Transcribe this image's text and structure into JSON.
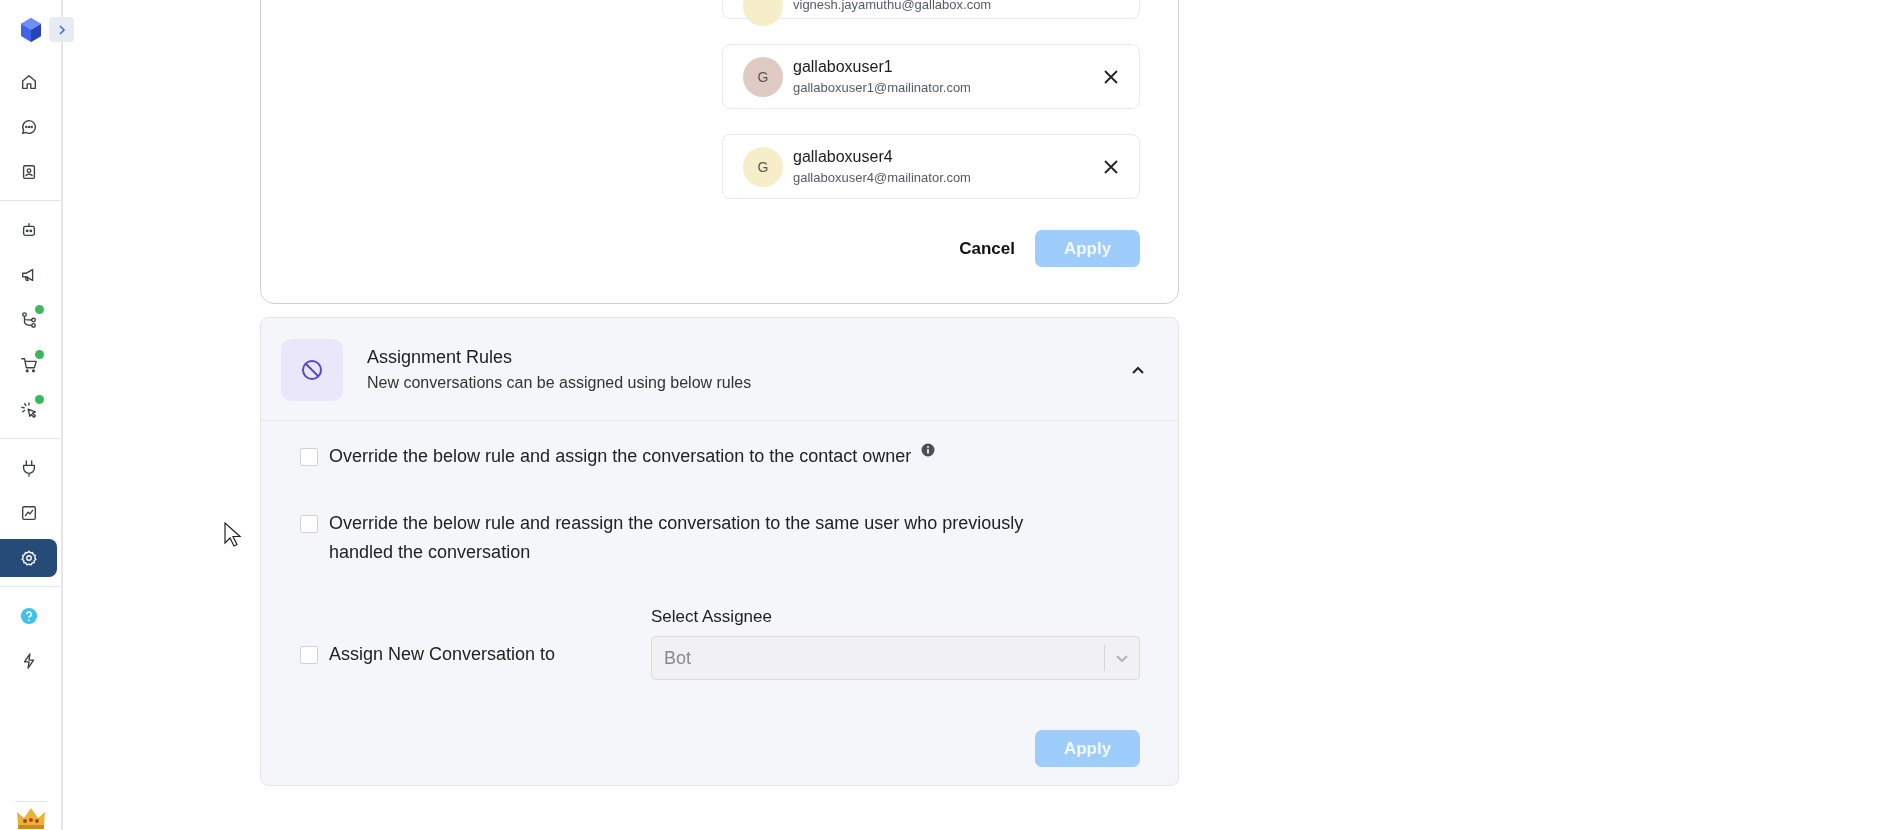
{
  "sidebar": {
    "groups": [
      [
        {
          "selected": false,
          "badge": false
        },
        {
          "selected": false,
          "badge": false
        },
        {
          "selected": false,
          "badge": false
        }
      ],
      [
        {
          "selected": false,
          "badge": false
        },
        {
          "selected": false,
          "badge": false
        },
        {
          "selected": false,
          "badge": true
        },
        {
          "selected": false,
          "badge": true
        },
        {
          "selected": false,
          "badge": true
        }
      ],
      [
        {
          "selected": false,
          "badge": false
        },
        {
          "selected": false,
          "badge": false
        },
        {
          "selected": true,
          "badge": false
        }
      ],
      [
        {
          "selected": false,
          "badge": false
        },
        {
          "selected": false,
          "badge": false
        }
      ]
    ]
  },
  "assignees": {
    "users": [
      {
        "email": "vignesh.jayamuthu@gallabox.com",
        "color": "#f6eec8"
      },
      {
        "initial": "G",
        "name": "gallaboxuser1",
        "email": "gallaboxuser1@mailinator.com",
        "color": "#e0cbc4"
      },
      {
        "initial": "G",
        "name": "gallaboxuser4",
        "email": "gallaboxuser4@mailinator.com",
        "color": "#f6eec8"
      }
    ],
    "cancel_button": {
      "label": "Cancel",
      "disabled": false
    },
    "apply_button": {
      "label": "Apply",
      "disabled": true
    }
  },
  "assignment_rules": {
    "title": "Assignment Rules",
    "subtitle": "New conversations can be assigned using below rules",
    "expanded": true,
    "rules": [
      {
        "kind": "checkbox",
        "label": "Override the below rule and assign the conversation to the contact owner",
        "checked": false,
        "info": true
      },
      {
        "kind": "checkbox",
        "label": "Override the below rule and reassign the conversation to the same user who previously handled the conversation",
        "checked": false,
        "info": false
      },
      {
        "kind": "select",
        "label": "Assign New Conversation to",
        "checked": false,
        "select_label": "Select Assignee",
        "value": "Bot",
        "disabled": true
      }
    ],
    "apply_button": {
      "label": "Apply",
      "disabled": true
    }
  }
}
